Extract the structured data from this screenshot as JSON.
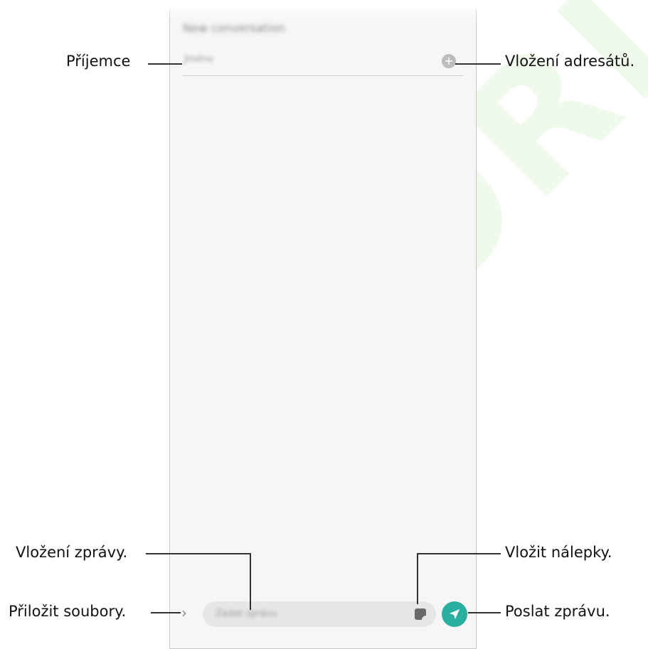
{
  "screen": {
    "title": "New conversation",
    "recipient_placeholder": "Jméno",
    "message_placeholder": "Zadat zprávu"
  },
  "callouts": {
    "recipient": "Příjemce",
    "add_recipients": "Vložení adresátů.",
    "enter_message": "Vložení zprávy.",
    "insert_stickers": "Vložit nálepky.",
    "attach_files": "Přiložit soubory.",
    "send_message": "Poslat zprávu."
  },
  "icons": {
    "add": "plus-circle-icon",
    "expand": "chevron-right-icon",
    "sticker": "sticker-icon",
    "send": "send-icon"
  },
  "colors": {
    "send_button": "#2aaea0"
  }
}
